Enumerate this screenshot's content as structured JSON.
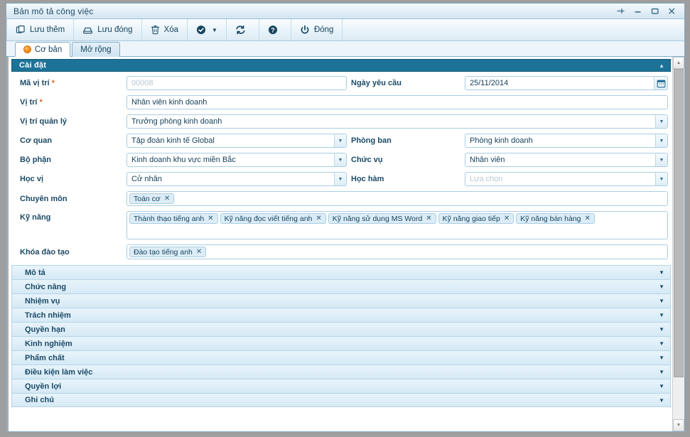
{
  "window": {
    "title": "Bản mô tả công việc",
    "controls": [
      {
        "name": "pin-icon",
        "label": "Pin"
      },
      {
        "name": "minimize-icon",
        "label": "Minimize"
      },
      {
        "name": "maximize-icon",
        "label": "Maximize"
      },
      {
        "name": "close-icon",
        "label": "Close"
      }
    ]
  },
  "toolbar": {
    "buttons": [
      {
        "label": "Lưu thêm",
        "icon": "copy-icon"
      },
      {
        "label": "Lưu đóng",
        "icon": "save-icon"
      },
      {
        "label": "Xóa",
        "icon": "trash-icon"
      },
      {
        "label": "",
        "icon": "check-circle-icon",
        "has_caret": true
      },
      {
        "label": "",
        "icon": "refresh-icon"
      },
      {
        "label": "",
        "icon": "help-icon"
      },
      {
        "label": "Đóng",
        "icon": "power-icon"
      }
    ]
  },
  "tabs": [
    {
      "label": "Cơ bản",
      "active": true
    },
    {
      "label": "Mở rộng",
      "active": false
    }
  ],
  "section": {
    "title": "Cài đặt",
    "collapse_icon": "chevron-up-icon"
  },
  "form": {
    "ma_vi_tri": {
      "label": "Mã vị trí",
      "required": true,
      "value": "00008",
      "readonly": true
    },
    "ngay_yeu_cau": {
      "label": "Ngày yêu cầu",
      "required": false,
      "value": "25/11/2014",
      "icon": "calendar-icon"
    },
    "vi_tri": {
      "label": "Vị trí",
      "required": true,
      "value": "Nhân viên kinh doanh"
    },
    "vi_tri_quan_ly": {
      "label": "Vị trí quản lý",
      "required": false,
      "value": "Trưởng phòng kinh doanh"
    },
    "co_quan": {
      "label": "Cơ quan",
      "required": false,
      "value": "Tập đoàn kinh tế Global"
    },
    "phong_ban": {
      "label": "Phòng ban",
      "required": false,
      "value": "Phòng kinh doanh"
    },
    "bo_phan": {
      "label": "Bộ phận",
      "required": false,
      "value": "Kinh doanh khu vực miền Bắc"
    },
    "chuc_vu": {
      "label": "Chức vụ",
      "required": false,
      "value": "Nhân viên"
    },
    "hoc_vi": {
      "label": "Học vị",
      "required": false,
      "value": "Cử nhân"
    },
    "hoc_ham": {
      "label": "Học hàm",
      "required": false,
      "value": "",
      "placeholder": "Lựa chọn"
    },
    "chuyen_mon": {
      "label": "Chuyên môn",
      "tags": [
        "Toán cơ"
      ]
    },
    "ky_nang": {
      "label": "Kỹ năng",
      "tags": [
        "Thành thạo tiếng anh",
        "Kỹ năng đọc viết tiếng anh",
        "Kỹ năng sử dụng MS Word",
        "Kỹ năng giao tiếp",
        "Kỹ năng bán hàng"
      ]
    },
    "khoa_dao_tao": {
      "label": "Khóa đào tạo",
      "tags": [
        "Đào tạo tiếng anh"
      ]
    }
  },
  "accordion": {
    "items": [
      {
        "label": "Mô tả"
      },
      {
        "label": "Chức năng"
      },
      {
        "label": "Nhiệm vụ"
      },
      {
        "label": "Trách nhiệm"
      },
      {
        "label": "Quyền hạn"
      },
      {
        "label": "Kinh nghiệm"
      },
      {
        "label": "Phẩm chất"
      },
      {
        "label": "Điều kiện làm việc"
      },
      {
        "label": "Quyền lợi"
      },
      {
        "label": "Ghi chú"
      }
    ],
    "expand_icon": "chevron-down-icon"
  },
  "colors": {
    "section_header": "#1d7298",
    "required_star": "#e8602c",
    "tab_accent": "#f08a1e",
    "label_text": "#1b4a66",
    "field_border": "#a9cde2"
  }
}
